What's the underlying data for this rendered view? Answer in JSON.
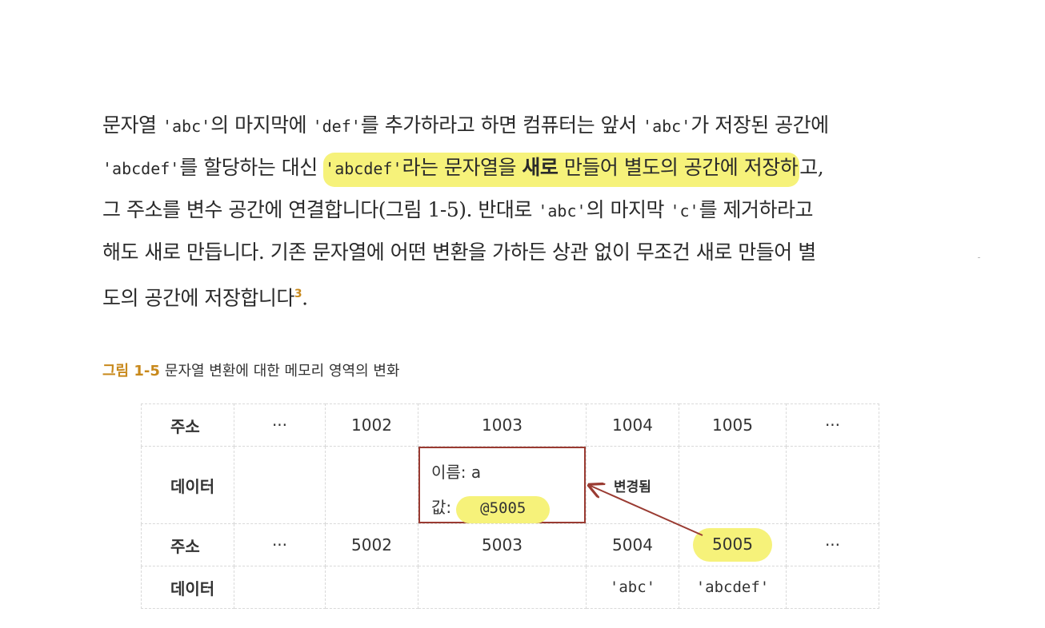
{
  "paragraph": {
    "l1_a": "문자열 ",
    "l1_code1": "'abc'",
    "l1_b": "의 마지막에 ",
    "l1_code2": "'def'",
    "l1_c": "를 추가하라고 하면 컴퓨터는 앞서 ",
    "l1_code3": "'abc'",
    "l1_d": "가 저장된 공간에",
    "l2_code1": "'abcdef'",
    "l2_a": "를 할당하는 대신 ",
    "l2_hl_code": "'abcdef'",
    "l2_hl_a": "라는 문자열을 ",
    "l2_hl_bold": "새로",
    "l2_hl_b": " 만들어 별도의 공간에 저장하",
    "l2_end": "고,",
    "l3_a": "그 주소를 변수 공간에 연결합니다(그림 1-5). 반대로 ",
    "l3_code1": "'abc'",
    "l3_b": "의 마지막 ",
    "l3_code2": "'c'",
    "l3_c": "를 제거하라고",
    "l4": "해도 새로 만듭니다. 기존 문자열에 어떤 변환을 가하든 상관 없이 무조건 새로 만들어 별",
    "l5": "도의 공간에 저장합니다",
    "l5_fn": "3",
    "l5_end": "."
  },
  "caption": {
    "number": "그림 1-5",
    "text": "문자열 변환에 대한 메모리 영역의 변화"
  },
  "memory_table": {
    "row1": [
      "주소",
      "···",
      "1002",
      "1003",
      "1004",
      "1005",
      "···"
    ],
    "row2": {
      "label": "데이터",
      "name_text": "이름: a",
      "value_label": "값:",
      "value": "@5005",
      "changed": "변경됨"
    },
    "row3": [
      "주소",
      "···",
      "5002",
      "5003",
      "5004",
      "5005",
      "···"
    ],
    "row4": {
      "label": "데이터",
      "c5": "'abc'",
      "c6": "'abcdef'"
    }
  },
  "colors": {
    "highlight": "#f6f27a",
    "caption_accent": "#c8891c",
    "box_border": "#9a3b32"
  }
}
